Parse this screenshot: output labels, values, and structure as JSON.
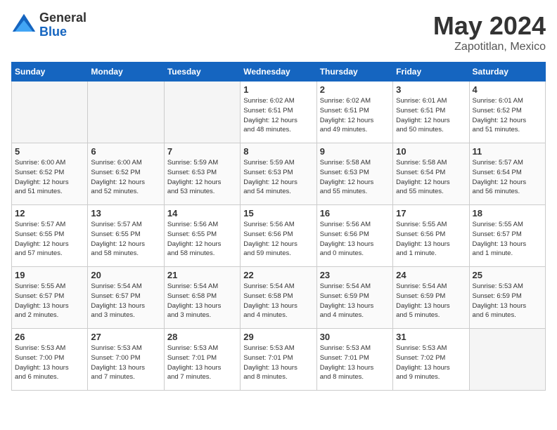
{
  "logo": {
    "general": "General",
    "blue": "Blue"
  },
  "title": {
    "month": "May 2024",
    "location": "Zapotitlan, Mexico"
  },
  "headers": [
    "Sunday",
    "Monday",
    "Tuesday",
    "Wednesday",
    "Thursday",
    "Friday",
    "Saturday"
  ],
  "weeks": [
    [
      {
        "day": "",
        "detail": ""
      },
      {
        "day": "",
        "detail": ""
      },
      {
        "day": "",
        "detail": ""
      },
      {
        "day": "1",
        "detail": "Sunrise: 6:02 AM\nSunset: 6:51 PM\nDaylight: 12 hours\nand 48 minutes."
      },
      {
        "day": "2",
        "detail": "Sunrise: 6:02 AM\nSunset: 6:51 PM\nDaylight: 12 hours\nand 49 minutes."
      },
      {
        "day": "3",
        "detail": "Sunrise: 6:01 AM\nSunset: 6:51 PM\nDaylight: 12 hours\nand 50 minutes."
      },
      {
        "day": "4",
        "detail": "Sunrise: 6:01 AM\nSunset: 6:52 PM\nDaylight: 12 hours\nand 51 minutes."
      }
    ],
    [
      {
        "day": "5",
        "detail": "Sunrise: 6:00 AM\nSunset: 6:52 PM\nDaylight: 12 hours\nand 51 minutes."
      },
      {
        "day": "6",
        "detail": "Sunrise: 6:00 AM\nSunset: 6:52 PM\nDaylight: 12 hours\nand 52 minutes."
      },
      {
        "day": "7",
        "detail": "Sunrise: 5:59 AM\nSunset: 6:53 PM\nDaylight: 12 hours\nand 53 minutes."
      },
      {
        "day": "8",
        "detail": "Sunrise: 5:59 AM\nSunset: 6:53 PM\nDaylight: 12 hours\nand 54 minutes."
      },
      {
        "day": "9",
        "detail": "Sunrise: 5:58 AM\nSunset: 6:53 PM\nDaylight: 12 hours\nand 55 minutes."
      },
      {
        "day": "10",
        "detail": "Sunrise: 5:58 AM\nSunset: 6:54 PM\nDaylight: 12 hours\nand 55 minutes."
      },
      {
        "day": "11",
        "detail": "Sunrise: 5:57 AM\nSunset: 6:54 PM\nDaylight: 12 hours\nand 56 minutes."
      }
    ],
    [
      {
        "day": "12",
        "detail": "Sunrise: 5:57 AM\nSunset: 6:55 PM\nDaylight: 12 hours\nand 57 minutes."
      },
      {
        "day": "13",
        "detail": "Sunrise: 5:57 AM\nSunset: 6:55 PM\nDaylight: 12 hours\nand 58 minutes."
      },
      {
        "day": "14",
        "detail": "Sunrise: 5:56 AM\nSunset: 6:55 PM\nDaylight: 12 hours\nand 58 minutes."
      },
      {
        "day": "15",
        "detail": "Sunrise: 5:56 AM\nSunset: 6:56 PM\nDaylight: 12 hours\nand 59 minutes."
      },
      {
        "day": "16",
        "detail": "Sunrise: 5:56 AM\nSunset: 6:56 PM\nDaylight: 13 hours\nand 0 minutes."
      },
      {
        "day": "17",
        "detail": "Sunrise: 5:55 AM\nSunset: 6:56 PM\nDaylight: 13 hours\nand 1 minute."
      },
      {
        "day": "18",
        "detail": "Sunrise: 5:55 AM\nSunset: 6:57 PM\nDaylight: 13 hours\nand 1 minute."
      }
    ],
    [
      {
        "day": "19",
        "detail": "Sunrise: 5:55 AM\nSunset: 6:57 PM\nDaylight: 13 hours\nand 2 minutes."
      },
      {
        "day": "20",
        "detail": "Sunrise: 5:54 AM\nSunset: 6:57 PM\nDaylight: 13 hours\nand 3 minutes."
      },
      {
        "day": "21",
        "detail": "Sunrise: 5:54 AM\nSunset: 6:58 PM\nDaylight: 13 hours\nand 3 minutes."
      },
      {
        "day": "22",
        "detail": "Sunrise: 5:54 AM\nSunset: 6:58 PM\nDaylight: 13 hours\nand 4 minutes."
      },
      {
        "day": "23",
        "detail": "Sunrise: 5:54 AM\nSunset: 6:59 PM\nDaylight: 13 hours\nand 4 minutes."
      },
      {
        "day": "24",
        "detail": "Sunrise: 5:54 AM\nSunset: 6:59 PM\nDaylight: 13 hours\nand 5 minutes."
      },
      {
        "day": "25",
        "detail": "Sunrise: 5:53 AM\nSunset: 6:59 PM\nDaylight: 13 hours\nand 6 minutes."
      }
    ],
    [
      {
        "day": "26",
        "detail": "Sunrise: 5:53 AM\nSunset: 7:00 PM\nDaylight: 13 hours\nand 6 minutes."
      },
      {
        "day": "27",
        "detail": "Sunrise: 5:53 AM\nSunset: 7:00 PM\nDaylight: 13 hours\nand 7 minutes."
      },
      {
        "day": "28",
        "detail": "Sunrise: 5:53 AM\nSunset: 7:01 PM\nDaylight: 13 hours\nand 7 minutes."
      },
      {
        "day": "29",
        "detail": "Sunrise: 5:53 AM\nSunset: 7:01 PM\nDaylight: 13 hours\nand 8 minutes."
      },
      {
        "day": "30",
        "detail": "Sunrise: 5:53 AM\nSunset: 7:01 PM\nDaylight: 13 hours\nand 8 minutes."
      },
      {
        "day": "31",
        "detail": "Sunrise: 5:53 AM\nSunset: 7:02 PM\nDaylight: 13 hours\nand 9 minutes."
      },
      {
        "day": "",
        "detail": ""
      }
    ]
  ]
}
